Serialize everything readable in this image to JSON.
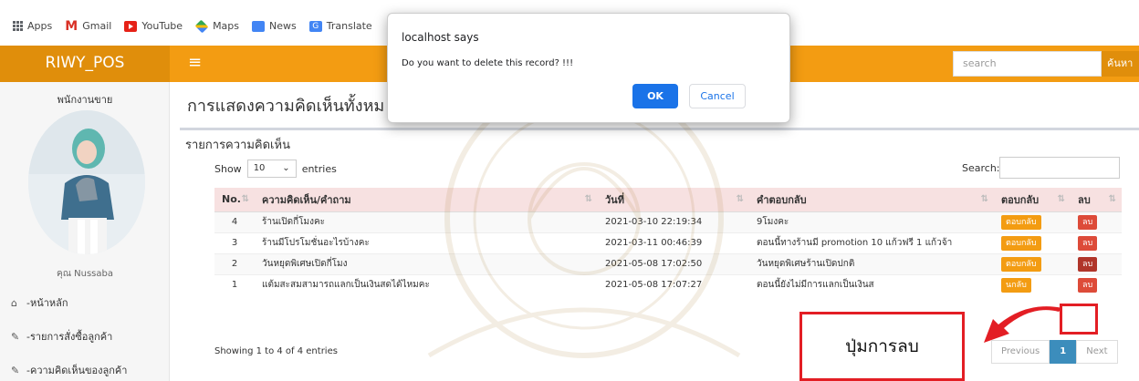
{
  "browser": {
    "bookmarks": [
      {
        "label": "Apps",
        "icon": "apps-icon"
      },
      {
        "label": "Gmail",
        "icon": "gmail-icon"
      },
      {
        "label": "YouTube",
        "icon": "youtube-icon"
      },
      {
        "label": "Maps",
        "icon": "maps-icon"
      },
      {
        "label": "News",
        "icon": "news-icon"
      },
      {
        "label": "Translate",
        "icon": "translate-icon"
      }
    ]
  },
  "header": {
    "brand": "RIWY_POS",
    "menu_icon": "≡",
    "search_placeholder": "search",
    "search_button": "ค้นหา",
    "color": "#f39c12"
  },
  "sidebar": {
    "role": "พนักงานขาย",
    "user": "คุณ Nussaba",
    "items": [
      {
        "label": "-หน้าหลัก",
        "icon": "home-icon"
      },
      {
        "label": "-รายการสั่งซื้อลูกค้า",
        "icon": "edit-icon"
      },
      {
        "label": "-ความคิดเห็นของลูกค้า",
        "icon": "edit-icon"
      }
    ]
  },
  "main": {
    "title": "การแสดงความคิดเห็นทั้งหม",
    "box_title": "รายการความคิดเห็น",
    "show_label": "Show",
    "show_value": "10",
    "entries_label": "entries",
    "search_label": "Search:",
    "columns": [
      "No.",
      "ความคิดเห็น/คำถาม",
      "วันที่",
      "คำตอบกลับ",
      "ตอบกลับ",
      "ลบ"
    ],
    "rows": [
      {
        "no": "4",
        "comment": "ร้านเปิดกี่โมงคะ",
        "date": "2021-03-10 22:19:34",
        "answer": "9โมงคะ",
        "reply": "ตอบกลับ",
        "del": "ลบ"
      },
      {
        "no": "3",
        "comment": "ร้านมีโปรโมชั่นอะไรบ้างคะ",
        "date": "2021-03-11 00:46:39",
        "answer": "ตอนนี้ทางร้านมี promotion 10 แก้วฟรี 1 แก้วจ้า",
        "reply": "ตอบกลับ",
        "del": "ลบ"
      },
      {
        "no": "2",
        "comment": "วันหยุดพิเศษเปิดกี่โมง",
        "date": "2021-05-08 17:02:50",
        "answer": "วันหยุดพิเศษร้านเปิดปกติ",
        "reply": "ตอบกลับ",
        "del": "ลบ"
      },
      {
        "no": "1",
        "comment": "แต้มสะสมสามารถแลกเป็นเงินสดได้ไหมคะ",
        "date": "2021-05-08 17:07:27",
        "answer": "ตอนนี้ยังไม่มีการแลกเป็นเงินส",
        "reply": "นกลับ",
        "del": "ลบ"
      }
    ],
    "info": "Showing 1 to 4 of 4 entries",
    "pager": {
      "prev": "Previous",
      "page": "1",
      "next": "Next"
    }
  },
  "annotation": {
    "label": "ปุ่มการลบ",
    "color": "#e31e24"
  },
  "dialog": {
    "title": "localhost says",
    "message": "Do you want to delete this record? !!!",
    "ok": "OK",
    "cancel": "Cancel"
  }
}
